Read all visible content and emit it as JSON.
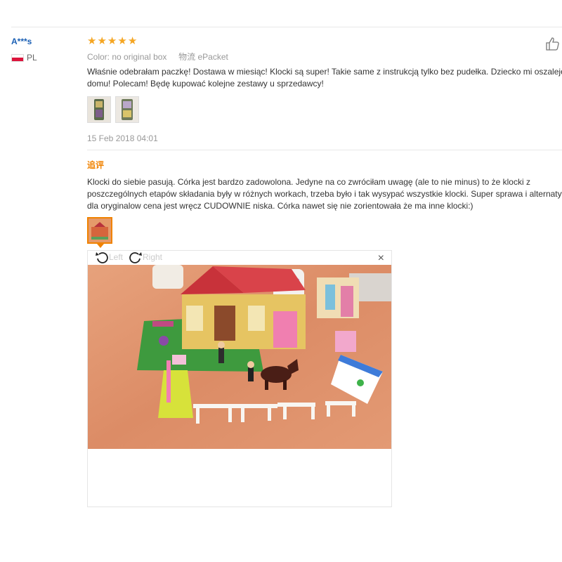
{
  "review": {
    "user_name": "A***s",
    "country": "PL",
    "rating": 5,
    "color_label": "Color:",
    "color_value": "no original box",
    "shipping_label": "物流",
    "shipping_value": "ePacket",
    "text_line1": "Właśnie odebrałam paczkę! Dostawa w miesiąc! Klocki są super! Takie same z instrukcją tylko bez pudełka. Dziecko mi oszaleje w",
    "text_line2": "domu! Polecam! Będę kupować kolejne zestawy u sprzedawcy!",
    "date": "15 Feb 2018 04:01",
    "additional_label": "追评",
    "add_line1": "Klocki do siebie pasują. Córka jest bardzo zadowolona. Jedyne na co zwróciłam uwagę (ale to nie minus) to że klocki z",
    "add_line2": "poszczególnych etapów składania były w różnych workach, trzeba było i tak wysypać wszystkie klocki. Super sprawa i alternatywa",
    "add_line3": "dla oryginalow cena jest wręcz CUDOWNIE niska. Córka nawet się nie zorientowała że ma inne klocki:)"
  },
  "viewer": {
    "rotate_left": "Left",
    "rotate_right": "Right",
    "close": "×"
  },
  "colors": {
    "accent": "#f08200",
    "star": "#f5a623",
    "link": "#1a5fb4"
  }
}
